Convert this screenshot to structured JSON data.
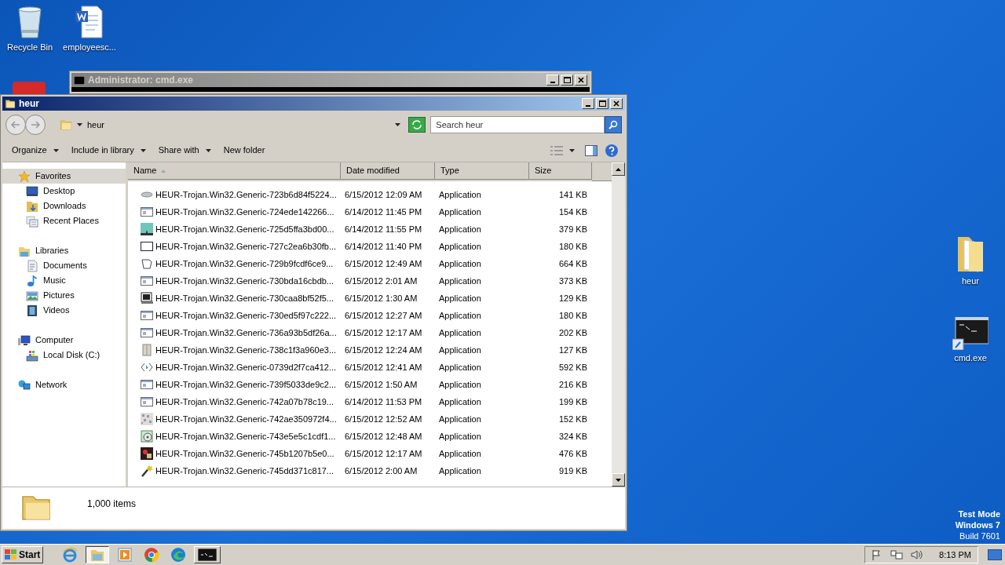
{
  "desktop_icons": [
    {
      "label": "Recycle Bin",
      "kind": "recycle"
    },
    {
      "label": "employeesc...",
      "kind": "document"
    }
  ],
  "desktop_icons_right": [
    {
      "label": "heur",
      "kind": "folder"
    },
    {
      "label": "cmd.exe",
      "kind": "console"
    }
  ],
  "desktop_notice": [
    "Test Mode",
    "Windows 7",
    "Build 7601"
  ],
  "cmd_window": {
    "title": "Administrator: cmd.exe"
  },
  "explorer": {
    "title": "heur",
    "address": "heur",
    "search": {
      "placeholder": "Search heur"
    },
    "toolbar": [
      {
        "label": "Organize",
        "dropdown": true
      },
      {
        "label": "Include in library",
        "dropdown": true
      },
      {
        "label": "Share with",
        "dropdown": true
      },
      {
        "label": "New folder",
        "dropdown": false
      }
    ],
    "nav": [
      {
        "label": "Favorites",
        "kind": "star",
        "selected": true,
        "children": [
          {
            "label": "Desktop",
            "kind": "desktop",
            "selected": false
          },
          {
            "label": "Downloads",
            "kind": "downloads",
            "selected": false
          },
          {
            "label": "Recent Places",
            "kind": "recent",
            "selected": false
          }
        ]
      },
      {
        "label": "Libraries",
        "kind": "library",
        "selected": false,
        "children": [
          {
            "label": "Documents",
            "kind": "documents",
            "selected": false
          },
          {
            "label": "Music",
            "kind": "music",
            "selected": false
          },
          {
            "label": "Pictures",
            "kind": "pictures",
            "selected": false
          },
          {
            "label": "Videos",
            "kind": "videos",
            "selected": false
          }
        ]
      },
      {
        "label": "Computer",
        "kind": "computer",
        "selected": false,
        "children": [
          {
            "label": "Local Disk (C:)",
            "kind": "disk",
            "selected": false
          }
        ]
      },
      {
        "label": "Network",
        "kind": "network",
        "selected": false
      }
    ],
    "columns": [
      {
        "label": "Name",
        "sorted": true
      },
      {
        "label": "Date modified",
        "sorted": false
      },
      {
        "label": "Type",
        "sorted": false
      },
      {
        "label": "Size",
        "sorted": false
      }
    ],
    "rows": [
      {
        "name": "HEUR-Trojan.Win32.Generic-723b6d84f5224...",
        "date": "6/15/2012 12:09 AM",
        "type": "Application",
        "size": "141 KB",
        "kind": "drive"
      },
      {
        "name": "HEUR-Trojan.Win32.Generic-724ede142266...",
        "date": "6/14/2012 11:45 PM",
        "type": "Application",
        "size": "154 KB",
        "kind": "window"
      },
      {
        "name": "HEUR-Trojan.Win32.Generic-725d5ffa3bd00...",
        "date": "6/14/2012 11:55 PM",
        "type": "Application",
        "size": "379 KB",
        "kind": "picture"
      },
      {
        "name": "HEUR-Trojan.Win32.Generic-727c2ea6b30fb...",
        "date": "6/14/2012 11:40 PM",
        "type": "Application",
        "size": "180 KB",
        "kind": "frame"
      },
      {
        "name": "HEUR-Trojan.Win32.Generic-729b9fcdf6ce9...",
        "date": "6/15/2012 12:49 AM",
        "type": "Application",
        "size": "664 KB",
        "kind": "scroll"
      },
      {
        "name": "HEUR-Trojan.Win32.Generic-730bda16cbdb...",
        "date": "6/15/2012 2:01 AM",
        "type": "Application",
        "size": "373 KB",
        "kind": "window"
      },
      {
        "name": "HEUR-Trojan.Win32.Generic-730caa8bf52f5...",
        "date": "6/15/2012 1:30 AM",
        "type": "Application",
        "size": "129 KB",
        "kind": "terminal"
      },
      {
        "name": "HEUR-Trojan.Win32.Generic-730ed5f97c222...",
        "date": "6/15/2012 12:27 AM",
        "type": "Application",
        "size": "180 KB",
        "kind": "window"
      },
      {
        "name": "HEUR-Trojan.Win32.Generic-736a93b5df26a...",
        "date": "6/15/2012 12:17 AM",
        "type": "Application",
        "size": "202 KB",
        "kind": "window"
      },
      {
        "name": "HEUR-Trojan.Win32.Generic-738c1f3a960e3...",
        "date": "6/15/2012 12:24 AM",
        "type": "Application",
        "size": "127 KB",
        "kind": "box"
      },
      {
        "name": "HEUR-Trojan.Win32.Generic-0739d2f7ca412...",
        "date": "6/15/2012 12:41 AM",
        "type": "Application",
        "size": "592 KB",
        "kind": "code"
      },
      {
        "name": "HEUR-Trojan.Win32.Generic-739f5033de9c2...",
        "date": "6/15/2012 1:50 AM",
        "type": "Application",
        "size": "216 KB",
        "kind": "window"
      },
      {
        "name": "HEUR-Trojan.Win32.Generic-742a07b78c19...",
        "date": "6/14/2012 11:53 PM",
        "type": "Application",
        "size": "199 KB",
        "kind": "window"
      },
      {
        "name": "HEUR-Trojan.Win32.Generic-742ae350972f4...",
        "date": "6/15/2012 12:52 AM",
        "type": "Application",
        "size": "152 KB",
        "kind": "noise"
      },
      {
        "name": "HEUR-Trojan.Win32.Generic-743e5e5c1cdf1...",
        "date": "6/15/2012 12:48 AM",
        "type": "Application",
        "size": "324 KB",
        "kind": "disc"
      },
      {
        "name": "HEUR-Trojan.Win32.Generic-745b1207b5e0...",
        "date": "6/15/2012 12:17 AM",
        "type": "Application",
        "size": "476 KB",
        "kind": "dark"
      },
      {
        "name": "HEUR-Trojan.Win32.Generic-745dd371c817...",
        "date": "6/15/2012 2:00 AM",
        "type": "Application",
        "size": "919 KB",
        "kind": "wand"
      }
    ],
    "status": "1,000 items"
  },
  "taskbar": {
    "start": "Start",
    "apps": [
      {
        "kind": "ie",
        "selected": false
      },
      {
        "kind": "explorer",
        "selected": true
      },
      {
        "kind": "media",
        "selected": false
      },
      {
        "kind": "chrome",
        "selected": false
      },
      {
        "kind": "edge",
        "selected": false
      },
      {
        "kind": "console",
        "selected": false
      }
    ],
    "clock": "8:13 PM"
  }
}
